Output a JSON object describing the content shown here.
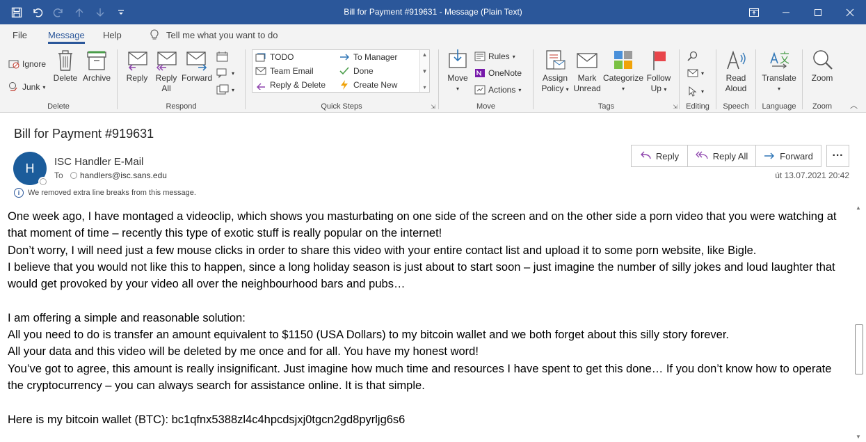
{
  "window": {
    "title": "Bill for Payment #919631  -  Message (Plain Text)"
  },
  "tabs": [
    {
      "label": "File"
    },
    {
      "label": "Message"
    },
    {
      "label": "Help"
    }
  ],
  "tellme": {
    "placeholder": "Tell me what you want to do"
  },
  "ribbon": {
    "delete_group": {
      "label": "Delete",
      "ignore": "Ignore",
      "junk": "Junk",
      "delete": "Delete",
      "archive": "Archive"
    },
    "respond_group": {
      "label": "Respond",
      "reply": "Reply",
      "reply_all_1": "Reply",
      "reply_all_2": "All",
      "forward": "Forward"
    },
    "quicksteps_group": {
      "label": "Quick Steps",
      "todo": "TODO",
      "team_email": "Team Email",
      "reply_delete": "Reply & Delete",
      "to_manager": "To Manager",
      "done": "Done",
      "create_new": "Create New"
    },
    "move_group": {
      "label": "Move",
      "move": "Move",
      "rules": "Rules",
      "onenote": "OneNote",
      "actions": "Actions"
    },
    "tags_group": {
      "label": "Tags",
      "assign_1": "Assign",
      "assign_2": "Policy",
      "mark_1": "Mark",
      "mark_2": "Unread",
      "categorize": "Categorize",
      "follow_1": "Follow",
      "follow_2": "Up"
    },
    "editing_group": {
      "label": "Editing"
    },
    "speech_group": {
      "label": "Speech",
      "read_1": "Read",
      "read_2": "Aloud"
    },
    "language_group": {
      "label": "Language",
      "translate": "Translate"
    },
    "zoom_group": {
      "label": "Zoom",
      "zoom": "Zoom"
    }
  },
  "message": {
    "subject": "Bill for Payment #919631",
    "avatar_initial": "H",
    "sender": "ISC Handler E-Mail",
    "to_label": "To",
    "to_value": "handlers@isc.sans.edu",
    "info": "We removed extra line breaks from this message.",
    "date": "út 13.07.2021 20:42",
    "actions": {
      "reply": "Reply",
      "reply_all": "Reply All",
      "forward": "Forward"
    },
    "body": [
      "One week ago, I have montaged a videoclip, which shows you masturbating on one side of the screen and on the other side a porn video that you were watching at that moment of time – recently this type of exotic stuff is really popular on the internet!",
      "Don’t worry, I will need just a few mouse clicks in order to share this video with your entire contact list and upload it to some porn website, like Bigle.",
      "I believe that you would not like this to happen, since a long holiday season is just about to start soon – just imagine the number of silly jokes and loud laughter that would get provoked by your video all over the neighbourhood bars and pubs…",
      "",
      "I am offering a simple and reasonable solution:",
      "All you need to do is transfer an amount equivalent to $1150 (USA Dollars) to my bitcoin wallet and we both forget about this silly story forever.",
      "All your data and this video will be deleted by me once and for all. You have my honest word!",
      "You’ve got to agree, this amount is really insignificant. Just imagine how much time and resources I have spent to get this done… If you don’t know how to operate the cryptocurrency – you can always search for assistance online. It is that simple.",
      "",
      "Here is my bitcoin wallet (BTC): bc1qfnx5388zl4c4hpcdsjxj0tgcn2gd8pyrljg6s6"
    ]
  }
}
